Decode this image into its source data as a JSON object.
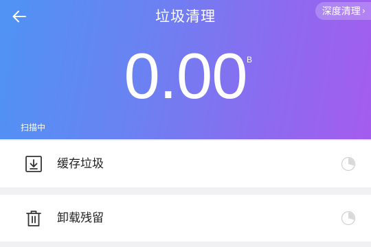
{
  "header": {
    "title": "垃圾清理",
    "deep_clean_label": "深度清理",
    "deep_clean_chevron": "›",
    "back_icon": "arrow-left-icon"
  },
  "summary": {
    "size_value": "0.00",
    "size_unit": "B",
    "status": "扫描中"
  },
  "categories": [
    {
      "label": "缓存垃圾",
      "icon": "download-icon"
    },
    {
      "label": "卸载残留",
      "icon": "trash-icon"
    }
  ],
  "colors": {
    "gradient_start": "#4f93f5",
    "gradient_end": "#a45cef",
    "row_background": "#ffffff",
    "page_background": "#f1f1f3"
  }
}
